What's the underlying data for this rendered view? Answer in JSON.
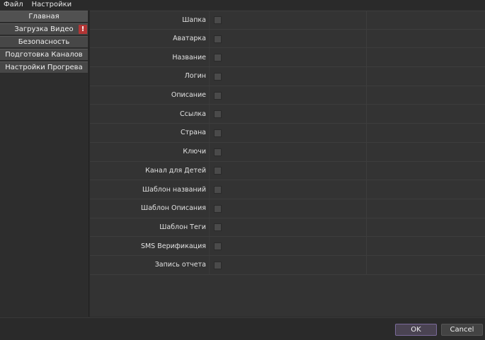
{
  "menu": {
    "items": [
      "Файл",
      "Настройки"
    ]
  },
  "sidebar": {
    "items": [
      {
        "label": "Главная"
      },
      {
        "label": "Загрузка Видео",
        "badge": "!"
      },
      {
        "label": "Безопасность"
      },
      {
        "label": "Подготовка Каналов"
      },
      {
        "label": "Настройки Прогрева"
      }
    ]
  },
  "form": {
    "rows": [
      {
        "label": "Шапка",
        "checked": false
      },
      {
        "label": "Аватарка",
        "checked": false
      },
      {
        "label": "Название",
        "checked": false
      },
      {
        "label": "Логин",
        "checked": false
      },
      {
        "label": "Описание",
        "checked": false
      },
      {
        "label": "Ссылка",
        "checked": false
      },
      {
        "label": "Страна",
        "checked": false
      },
      {
        "label": "Ключи",
        "checked": false
      },
      {
        "label": "Канал для Детей",
        "checked": false
      },
      {
        "label": "Шаблон названий",
        "checked": false
      },
      {
        "label": "Шаблон Описания",
        "checked": false
      },
      {
        "label": "Шаблон Теги",
        "checked": false
      },
      {
        "label": "SMS Верификация",
        "checked": false
      },
      {
        "label": "Запись отчета",
        "checked": false
      }
    ]
  },
  "footer": {
    "ok_label": "OK",
    "cancel_label": "Cancel"
  },
  "colors": {
    "ok_border": "#7a6a9a",
    "badge": "#b23535"
  }
}
